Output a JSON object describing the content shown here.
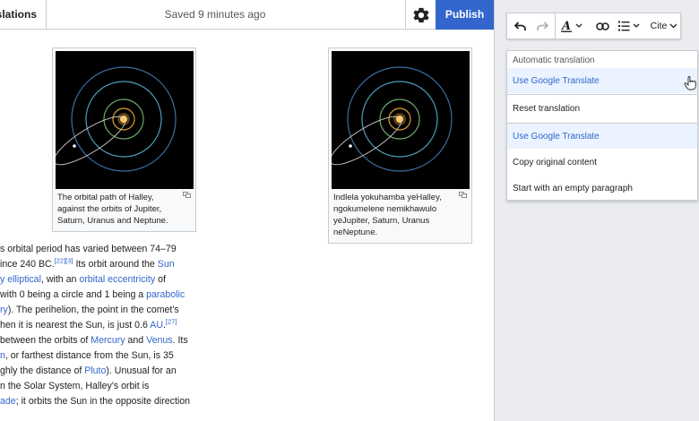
{
  "topbar": {
    "brand": "Translations",
    "saved_status": "Saved 9 minutes ago",
    "settings_icon": "gear-icon",
    "publish_label": "Publish"
  },
  "figures": [
    {
      "caption_lines": [
        "The orbital path of Halley,",
        "against the orbits of Jupiter,",
        "Saturn, Uranus and Neptune."
      ]
    },
    {
      "caption_lines": [
        "Indlela yokuhamba yeHalley,",
        "ngokumelene nemikhawulo",
        "yeJupiter, Saturn, Uranus",
        "neNeptune."
      ]
    }
  ],
  "article": {
    "l1": "s orbital period has varied between 74–79",
    "l2a": "ince 240 BC.",
    "l2s1": "[22]",
    "l2s2": "[3]",
    "l2b": " Its orbit around the ",
    "l2link": "Sun",
    "l3link1": "y elliptical",
    "l3a": ", with an ",
    "l3link2": "orbital eccentricity",
    "l3b": " of",
    "l4a": "with 0 being a circle and 1 being a ",
    "l4link": "parabolic",
    "l5link": "ry",
    "l5a": "). The perihelion, the point in the comet's",
    "l6a": "hen it is nearest the Sun, is just 0.6 ",
    "l6link": "AU",
    "l6b": ".",
    "l6sup": "[27]",
    "l7a": "between the orbits of ",
    "l7link1": "Mercury",
    "l7b": " and ",
    "l7link2": "Venus",
    "l7c": ". Its",
    "l8link": "n",
    "l8a": ", or farthest distance from the Sun, is 35",
    "l9a": "ghly the distance of ",
    "l9link": "Pluto",
    "l9b": "). Unusual for an",
    "l10a": "n the Solar System, Halley's orbit is",
    "l11link": "ade",
    "l11a": "; it orbits the Sun in the opposite direction"
  },
  "toolbar": {
    "undo_icon": "undo-icon",
    "redo_icon": "redo-icon",
    "text_style_icon": "text-style-icon",
    "link_icon": "link-icon",
    "list_icon": "list-icon",
    "cite_label": "Cite"
  },
  "menu": {
    "header": "Automatic translation",
    "items": [
      "Use Google Translate",
      "Reset translation",
      "Use Google Translate",
      "Copy original content",
      "Start with an empty paragraph"
    ]
  },
  "colors": {
    "accent": "#3366cc",
    "highlight": "#eaf3ff",
    "sidebar": "#eaecf0"
  }
}
